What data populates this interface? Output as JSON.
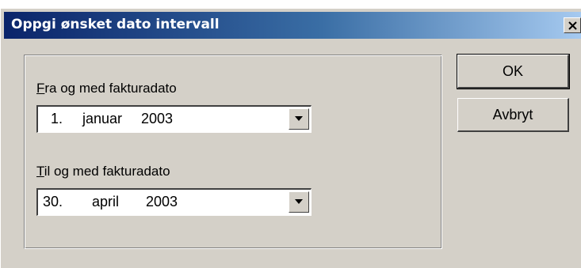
{
  "dialog": {
    "title": "Oppgi ønsket dato intervall",
    "close_icon": "close-icon",
    "from": {
      "label_accel": "F",
      "label_rest": "ra og med fakturadato",
      "day": "1.",
      "month": "januar",
      "year": "2003"
    },
    "to": {
      "label_accel": "T",
      "label_rest": "il og med fakturadato",
      "day": "30.",
      "month": "april",
      "year": "2003"
    },
    "ok_label": "OK",
    "cancel_label": "Avbryt",
    "colors": {
      "face": "#d4d0c8",
      "title_start": "#0a246a",
      "title_end": "#a6caf0"
    }
  }
}
